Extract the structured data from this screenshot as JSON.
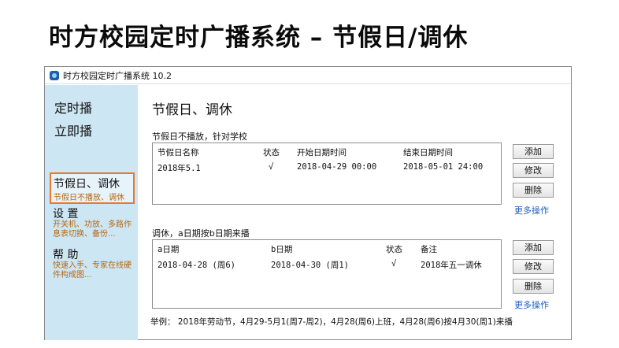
{
  "headline": "时方校园定时广播系统 – 节假日/调休",
  "window": {
    "title": "时方校园定时广播系统 10.2"
  },
  "sidebar": {
    "timed_broadcast": "定时播",
    "instant_broadcast": "立即播",
    "holidays": {
      "title": "节假日、调休",
      "subtitle": "节假日不播放、调休"
    },
    "settings": {
      "title": "设 置",
      "subtitle": "开关机、功放、多路作息表切换、备份..."
    },
    "help": {
      "title": "帮 助",
      "subtitle": "快速入手、专家在线硬件构成图..."
    }
  },
  "main": {
    "title": "节假日、调休",
    "holiday_section": {
      "label": "节假日不播放，针对学校",
      "columns": [
        "节假日名称",
        "状态",
        "开始日期时间",
        "结束日期时间"
      ],
      "rows": [
        {
          "name": "2018年5.1",
          "status": "√",
          "start": "2018-04-29 00:00",
          "end": "2018-05-01 24:00"
        }
      ],
      "buttons": {
        "add": "添加",
        "modify": "修改",
        "delete": "删除"
      },
      "more": "更多操作"
    },
    "swap_section": {
      "label": "调休，a日期按b日期来播",
      "columns": [
        "a日期",
        "b日期",
        "状态",
        "备注"
      ],
      "rows": [
        {
          "a": "2018-04-28 (周6)",
          "b": "2018-04-30 (周1)",
          "status": "√",
          "note": "2018年五一调休"
        }
      ],
      "buttons": {
        "add": "添加",
        "modify": "修改",
        "delete": "删除"
      },
      "more": "更多操作"
    },
    "footer": "举例：  2018年劳动节，4月29-5月1(周7-周2)，4月28(周6)上班，4月28(周6)按4月30(周1)来播"
  }
}
